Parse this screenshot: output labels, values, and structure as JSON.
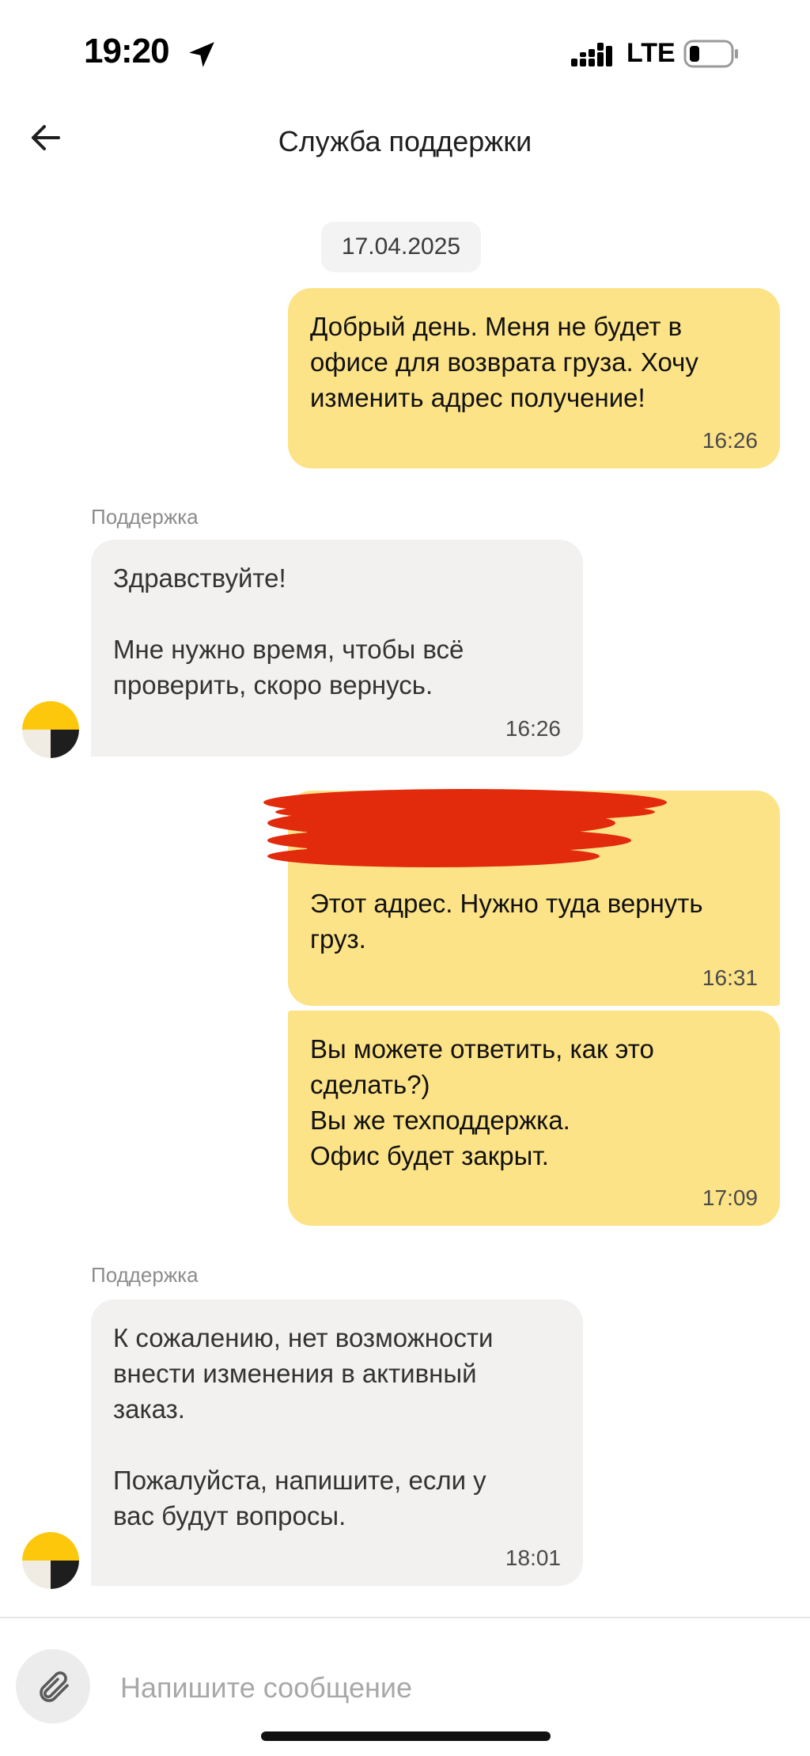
{
  "status_bar": {
    "time": "19:20",
    "network": "LTE"
  },
  "header": {
    "title": "Служба поддержки"
  },
  "date_chip": "17.04.2025",
  "messages": [
    {
      "from": "user",
      "text": "Добрый день. Меня не будет в\nофисе для возврата груза. Хочу\nизменить адрес получение!",
      "time": "16:26"
    },
    {
      "from": "support",
      "sender": "Поддержка",
      "text": "Здравствуйте!\n\nМне нужно время, чтобы всё\nпроверить, скоро вернусь.",
      "time": "16:26"
    },
    {
      "from": "user",
      "text": "Этот адрес. Нужно туда вернуть\nгруз.",
      "time": "16:31",
      "redacted": true
    },
    {
      "from": "user",
      "text": "Вы можете ответить, как это\nсделать?)\nВы же техподдержка.\nОфис будет закрыт.",
      "time": "17:09"
    },
    {
      "from": "support",
      "sender": "Поддержка",
      "text": "К сожалению, нет возможности\nвнести изменения в активный\nзаказ.\n\nПожалуйста, напишите, если у\nвас будут вопросы.",
      "time": "18:01"
    }
  ],
  "composer": {
    "placeholder": "Напишите сообщение"
  },
  "icons": {
    "back": "arrow-left-icon",
    "attach": "paperclip-icon",
    "avatar": "support-avatar",
    "location": "location-arrow-icon",
    "signal": "signal-icon",
    "battery": "battery-icon"
  },
  "colors": {
    "user_bubble": "#fde387",
    "support_bubble": "#f2f1ef",
    "avatar_yellow": "#fdc80b",
    "redaction": "#e22a0c"
  }
}
